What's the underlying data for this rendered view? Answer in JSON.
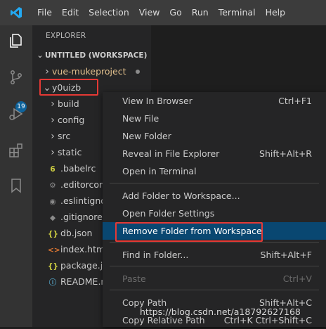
{
  "menu": [
    "File",
    "Edit",
    "Selection",
    "View",
    "Go",
    "Run",
    "Terminal",
    "Help"
  ],
  "activity_bar": {
    "icons": [
      "explorer-icon",
      "source-control-icon",
      "run-debug-icon",
      "extensions-icon",
      "bookmark-icon"
    ],
    "source_control_badge": "19"
  },
  "sidebar": {
    "title": "EXPLORER",
    "workspace_header": "UNTITLED (WORKSPACE)",
    "items": [
      {
        "label": "vue-mukeproject",
        "type": "folder",
        "state": "collapsed",
        "modified": true
      },
      {
        "label": "y0uizb",
        "type": "folder",
        "state": "expanded"
      },
      {
        "label": "build",
        "type": "folder",
        "state": "collapsed"
      },
      {
        "label": "config",
        "type": "folder",
        "state": "collapsed"
      },
      {
        "label": "src",
        "type": "folder",
        "state": "collapsed"
      },
      {
        "label": "static",
        "type": "folder",
        "state": "collapsed"
      },
      {
        "label": ".babelrc",
        "type": "file",
        "icon": "babel-icon",
        "color": "#cbcb41"
      },
      {
        "label": ".editorconfig",
        "type": "file",
        "icon": "gear-icon",
        "color": "#8a8a8a"
      },
      {
        "label": ".eslintignore",
        "type": "file",
        "icon": "eslint-icon",
        "color": "#8a8a8a"
      },
      {
        "label": ".gitignore",
        "type": "file",
        "icon": "git-icon",
        "color": "#8a8a8a"
      },
      {
        "label": "db.json",
        "type": "file",
        "icon": "json-icon",
        "color": "#cbcb41"
      },
      {
        "label": "index.html",
        "type": "file",
        "icon": "html-icon",
        "color": "#e37933"
      },
      {
        "label": "package.json",
        "type": "file",
        "icon": "json-icon",
        "color": "#cbcb41"
      },
      {
        "label": "README.md",
        "type": "file",
        "icon": "info-icon",
        "color": "#519aba"
      }
    ]
  },
  "context_menu": {
    "items": [
      {
        "label": "View In Browser",
        "shortcut": "Ctrl+F1"
      },
      {
        "label": "New File",
        "shortcut": ""
      },
      {
        "label": "New Folder",
        "shortcut": ""
      },
      {
        "label": "Reveal in File Explorer",
        "shortcut": "Shift+Alt+R"
      },
      {
        "label": "Open in Terminal",
        "shortcut": ""
      },
      {
        "label": "Add Folder to Workspace...",
        "shortcut": ""
      },
      {
        "label": "Open Folder Settings",
        "shortcut": ""
      },
      {
        "label": "Remove Folder from Workspace",
        "shortcut": "",
        "highlighted": true
      },
      {
        "label": "Find in Folder...",
        "shortcut": "Shift+Alt+F"
      },
      {
        "label": "Paste",
        "shortcut": "Ctrl+V",
        "disabled": true
      },
      {
        "label": "Copy Path",
        "shortcut": "Shift+Alt+C"
      },
      {
        "label": "Copy Relative Path",
        "shortcut": "Ctrl+K Ctrl+Shift+C"
      }
    ]
  },
  "watermark": "https://blog.csdn.net/a18792627168",
  "colors": {
    "highlight": "#094771",
    "annotation_red": "#e53935",
    "badge": "#0e639c"
  }
}
